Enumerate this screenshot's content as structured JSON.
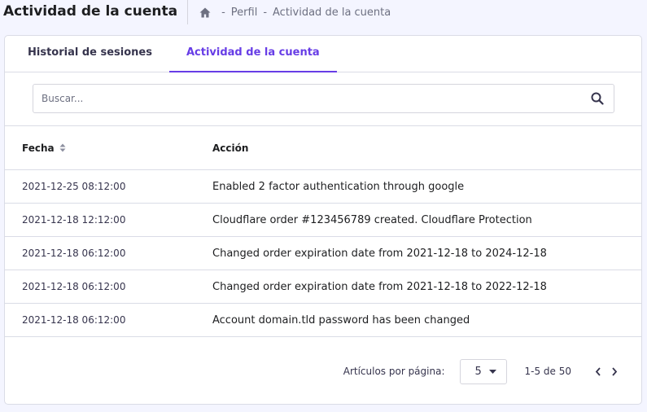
{
  "header": {
    "title": "Actividad de la cuenta",
    "breadcrumb": [
      "Perfil",
      "Actividad de la cuenta"
    ],
    "separator": "-"
  },
  "tabs": [
    {
      "label": "Historial de sesiones",
      "active": false
    },
    {
      "label": "Actividad de la cuenta",
      "active": true
    }
  ],
  "search": {
    "placeholder": "Buscar...",
    "value": ""
  },
  "table": {
    "columns": [
      "Fecha",
      "Acción"
    ],
    "rows": [
      {
        "date": "2021-12-25 08:12:00",
        "action": "Enabled 2 factor authentication through google"
      },
      {
        "date": "2021-12-18 12:12:00",
        "action": "Cloudflare order #123456789 created. Cloudflare Protection"
      },
      {
        "date": "2021-12-18 06:12:00",
        "action": "Changed order expiration date from 2021-12-18 to 2024-12-18"
      },
      {
        "date": "2021-12-18 06:12:00",
        "action": "Changed order expiration date from 2021-12-18 to 2022-12-18"
      },
      {
        "date": "2021-12-18 06:12:00",
        "action": "Account domain.tld password has been changed"
      }
    ]
  },
  "pagination": {
    "per_page_label": "Artículos por página:",
    "per_page_value": "5",
    "range": "1-5 de 50"
  },
  "colors": {
    "accent": "#673de6",
    "border": "#dadce6",
    "text": "#1d1e20"
  }
}
